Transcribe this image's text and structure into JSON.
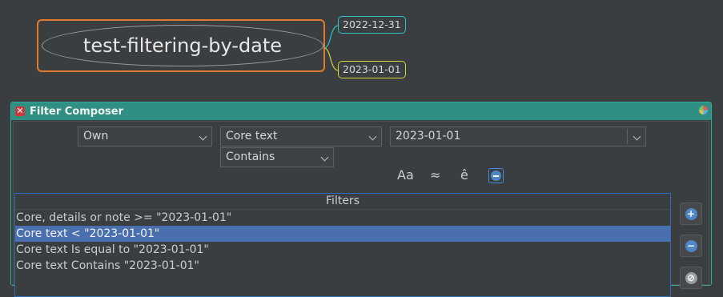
{
  "mindmap": {
    "root_label": "test-filtering-by-date",
    "date_node_1": "2022-12-31",
    "date_node_2": "2023-01-01"
  },
  "dialog": {
    "title": "Filter Composer",
    "scope_select": "Own",
    "property_select": "Core text",
    "condition_select": "Contains",
    "value_field": "2023-01-01",
    "tools": {
      "match_case": "Aa",
      "approximate": "≈",
      "ignore_diacritics": "ê"
    },
    "filters_header": "Filters",
    "filters": [
      "Core, details or note >= \"2023-01-01\"",
      "Core text < \"2023-01-01\"",
      "Core text Is equal to \"2023-01-01\"",
      "Core text Contains \"2023-01-01\""
    ],
    "selected_filter_index": 1,
    "colors": {
      "titlebar": "#2f8f82",
      "selection": "#4a6fae",
      "root_border": "#e07a2c"
    }
  }
}
